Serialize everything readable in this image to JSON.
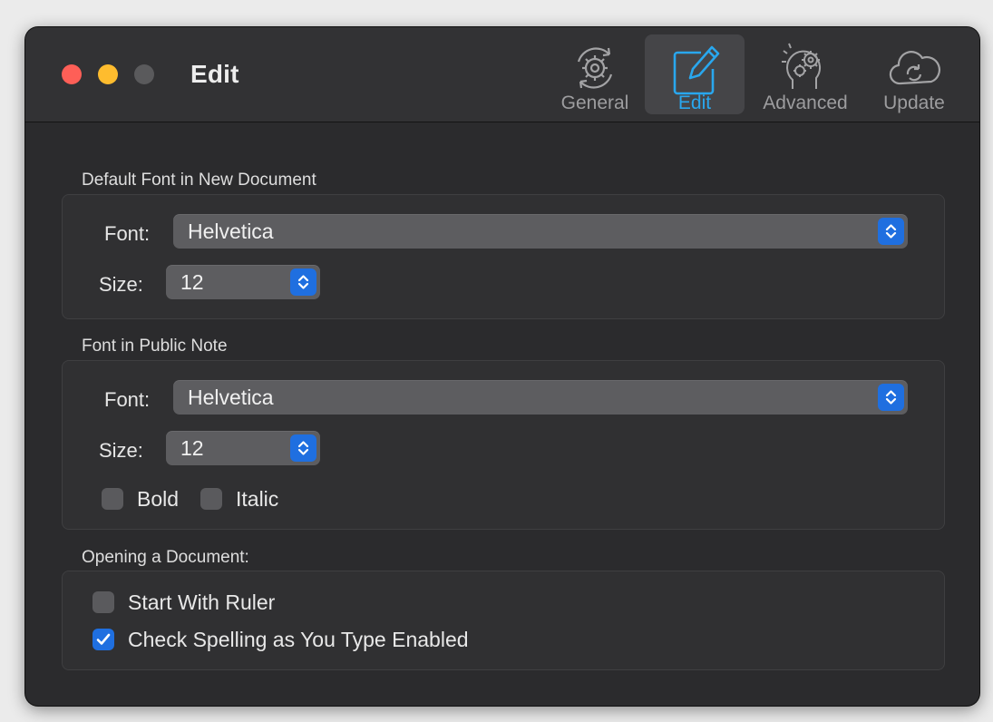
{
  "window": {
    "title": "Edit"
  },
  "toolbar": {
    "items": [
      {
        "label": "General",
        "icon": "gear-refresh-icon",
        "selected": false
      },
      {
        "label": "Edit",
        "icon": "pencil-square-icon",
        "selected": true
      },
      {
        "label": "Advanced",
        "icon": "head-gears-icon",
        "selected": false
      },
      {
        "label": "Update",
        "icon": "cloud-refresh-icon",
        "selected": false
      }
    ]
  },
  "default_font": {
    "title": "Default Font in New Document",
    "font_label": "Font:",
    "font_value": "Helvetica",
    "size_label": "Size:",
    "size_value": "12"
  },
  "public_note": {
    "title": "Font in Public Note",
    "font_label": "Font:",
    "font_value": "Helvetica",
    "size_label": "Size:",
    "size_value": "12",
    "bold_label": "Bold",
    "bold_checked": false,
    "italic_label": "Italic",
    "italic_checked": false
  },
  "opening": {
    "title": "Opening a Document:",
    "ruler_label": "Start With Ruler",
    "ruler_checked": false,
    "spelling_label": "Check Spelling as You Type Enabled",
    "spelling_checked": true
  },
  "colors": {
    "accent": "#1f6fe0",
    "selected_label": "#29a7ee",
    "close": "#fe5f57",
    "minimize": "#febc2e"
  }
}
